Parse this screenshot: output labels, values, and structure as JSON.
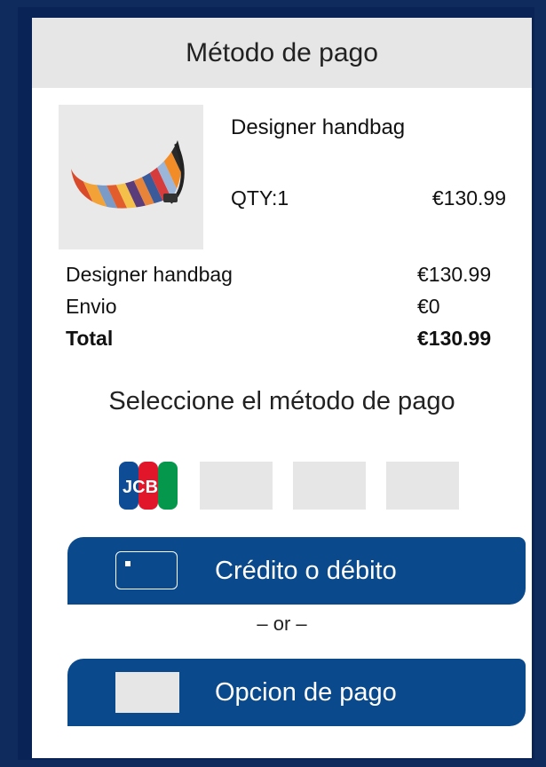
{
  "header": {
    "title": "Método de pago"
  },
  "product": {
    "name": "Designer handbag",
    "qty": "QTY:1",
    "price": "€130.99",
    "image_icon": "handbag-image"
  },
  "summary": {
    "rows": [
      {
        "label": "Designer handbag",
        "value": "€130.99"
      },
      {
        "label": "Envio",
        "value": "€0"
      }
    ],
    "total": {
      "label": "Total",
      "value": "€130.99"
    }
  },
  "payment": {
    "select_title": "Seleccione el método de pago",
    "methods": [
      {
        "name": "jcb",
        "logo_text": "JCB"
      },
      {
        "name": "placeholder"
      },
      {
        "name": "placeholder"
      },
      {
        "name": "placeholder"
      }
    ],
    "card_button": {
      "label": "Crédito o débito",
      "icon": "credit-card-icon"
    },
    "separator": "– or –",
    "option_button": {
      "label": "Opcion de pago"
    }
  },
  "colors": {
    "frame": "#0a2356",
    "button": "#0a4a8c",
    "header_bg": "#e6e6e6"
  }
}
